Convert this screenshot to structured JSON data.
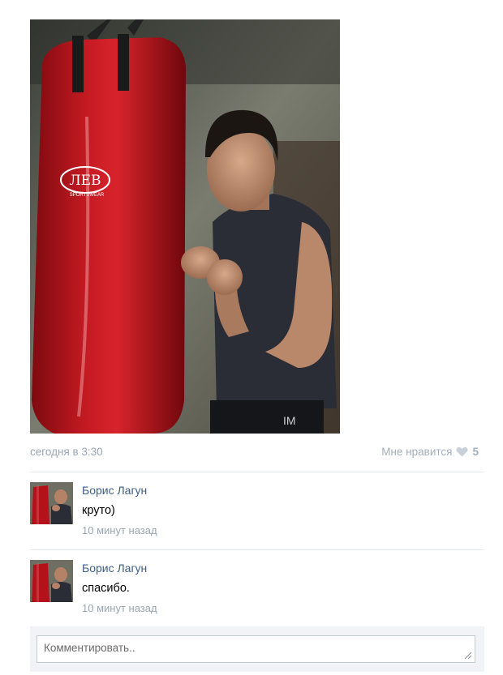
{
  "post": {
    "date": "сегодня в 3:30",
    "like_label": "Мне нравится",
    "like_count": "5",
    "photo": {
      "bag_brand": "ЛЕВ",
      "bag_subtext": "SPORTSWEAR",
      "shorts_text": "IM"
    }
  },
  "comments": [
    {
      "author": "Борис Лагун",
      "text": "круто)",
      "time": "10 минут назад"
    },
    {
      "author": "Борис Лагун",
      "text": "спасибо.",
      "time": "10 минут назад"
    }
  ],
  "reply": {
    "placeholder": "Комментировать.."
  },
  "colors": {
    "link": "#3b5e88",
    "meta": "#9aa5b4",
    "panel": "#f1f3f6",
    "bag": "#b8131c"
  }
}
